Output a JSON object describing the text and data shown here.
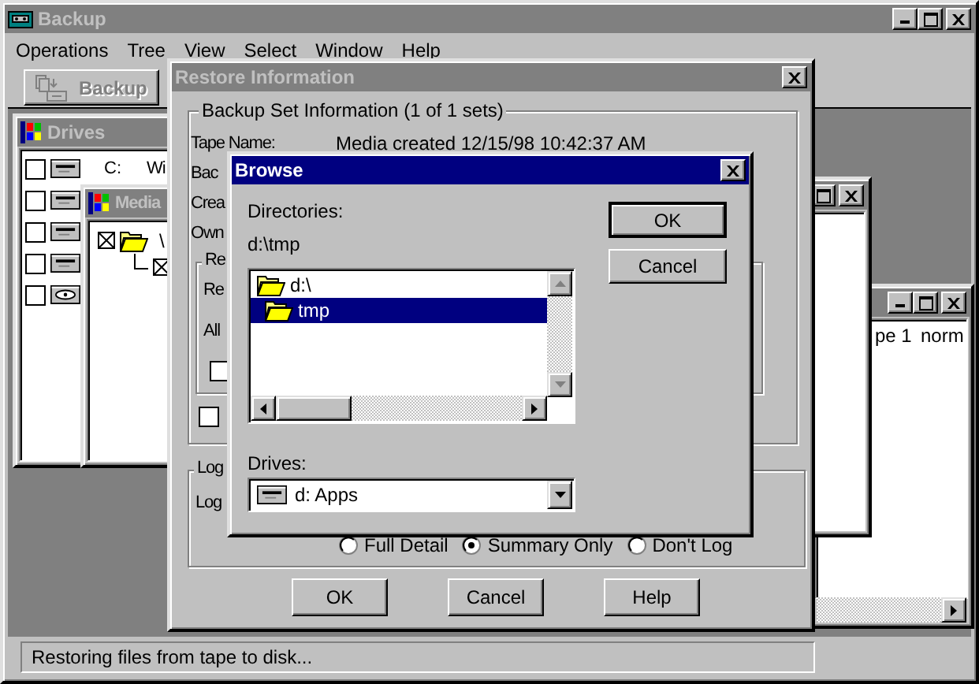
{
  "main_window": {
    "title": "Backup",
    "active": false,
    "menu": [
      {
        "label": "Operations"
      },
      {
        "label": "Tree"
      },
      {
        "label": "View"
      },
      {
        "label": "Select"
      },
      {
        "label": "Window"
      },
      {
        "label": "Help"
      }
    ],
    "toolbar": [
      {
        "label": "Backup",
        "disabled": true
      }
    ],
    "status_bar": "Restoring files from tape to disk..."
  },
  "drives_window": {
    "title": "Drives",
    "active": false,
    "rows": [
      {
        "kind": "disk",
        "checked": false,
        "name": "C:",
        "label": "Wi"
      },
      {
        "kind": "disk",
        "checked": false
      },
      {
        "kind": "disk",
        "checked": false
      },
      {
        "kind": "disk",
        "checked": false
      },
      {
        "kind": "cdrom",
        "checked": false
      }
    ]
  },
  "media_window": {
    "title": "Media",
    "active": false,
    "tree": [
      {
        "checked": true,
        "label": "\\",
        "children": [
          {
            "checked": true
          }
        ]
      }
    ]
  },
  "tape_window": {
    "cells": [
      "pe 1",
      "norm"
    ]
  },
  "restore_dialog": {
    "title": "Restore Information",
    "active": false,
    "set_group": {
      "legend": "Backup Set Information (1 of 1 sets)",
      "fields": [
        {
          "label": "Tape Name:",
          "value": "Media created 12/15/98 10:42:37 AM"
        },
        {
          "label": "Bac"
        },
        {
          "label": "Crea"
        },
        {
          "label": "Own"
        }
      ],
      "restore_group": {
        "legend": "Re",
        "label": "Re",
        "option_label": "All",
        "checked": false
      },
      "checked": false
    },
    "log_group": {
      "legend": "Log",
      "label": "Log",
      "options": [
        {
          "label": "Full Detail",
          "selected": false
        },
        {
          "label": "Summary Only",
          "selected": true
        },
        {
          "label": "Don't Log",
          "selected": false
        }
      ]
    },
    "buttons": [
      {
        "label": "OK"
      },
      {
        "label": "Cancel"
      },
      {
        "label": "Help"
      }
    ]
  },
  "browse_dialog": {
    "title": "Browse",
    "active": true,
    "directories_label": "Directories:",
    "current_path": "d:\\tmp",
    "directories": [
      {
        "label": "d:\\",
        "selected": false,
        "children": [
          {
            "label": "tmp",
            "selected": true
          }
        ]
      }
    ],
    "drives_label": "Drives:",
    "drive": {
      "kind": "disk",
      "label": "d: Apps"
    },
    "buttons": [
      {
        "label": "OK",
        "default": true
      },
      {
        "label": "Cancel",
        "default": false
      }
    ]
  }
}
